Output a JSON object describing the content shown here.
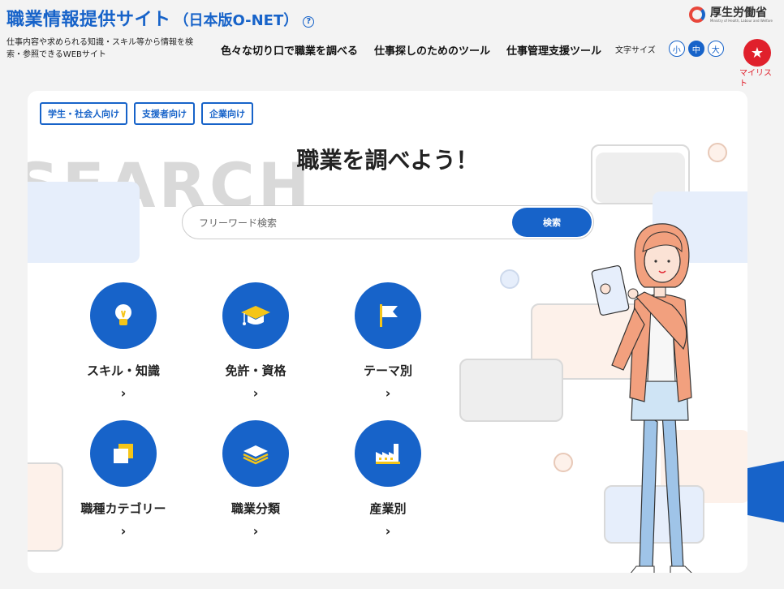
{
  "header": {
    "title": "職業情報提供サイト",
    "subtitle": "（日本版O-NET）",
    "help_icon": "question-circle-icon",
    "description": "仕事内容や求められる知識・スキル等から情報を検索・参照できるWEBサイト",
    "ministry": "厚生労働省",
    "ministry_en": "Ministry of Health, Labour and Welfare"
  },
  "nav": {
    "items": [
      "色々な切り口で職業を調べる",
      "仕事探しのためのツール",
      "仕事管理支援ツール"
    ]
  },
  "font_size": {
    "label": "文字サイズ",
    "options": [
      "小",
      "中",
      "大"
    ],
    "selected": "中"
  },
  "mylist": {
    "label": "マイリスト",
    "icon": "star-icon"
  },
  "main": {
    "audience_tabs": [
      "学生・社会人向け",
      "支援者向け",
      "企業向け"
    ],
    "background_word": "SEARCH",
    "heading": "職業を調べよう！",
    "search": {
      "placeholder": "フリーワード検索",
      "button": "検索"
    },
    "categories": [
      {
        "label": "スキル・知識",
        "icon": "lightbulb-icon"
      },
      {
        "label": "免許・資格",
        "icon": "graduation-cap-icon"
      },
      {
        "label": "テーマ別",
        "icon": "flag-icon"
      },
      {
        "label": "職種カテゴリー",
        "icon": "stacked-squares-icon"
      },
      {
        "label": "職業分類",
        "icon": "layers-icon"
      },
      {
        "label": "産業別",
        "icon": "factory-icon"
      }
    ]
  },
  "colors": {
    "brand": "#1763c9",
    "accent": "#e0202c",
    "background": "#f3f3f3"
  }
}
